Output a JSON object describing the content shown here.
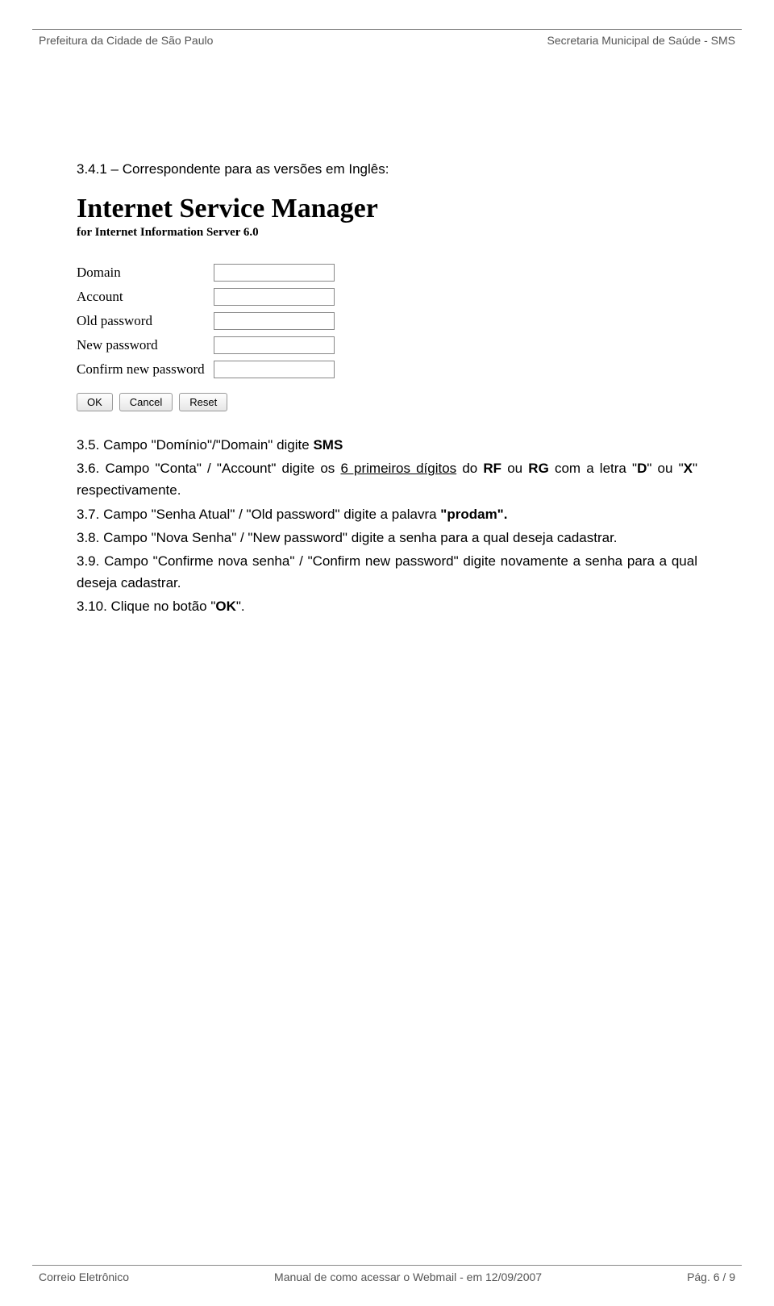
{
  "header": {
    "left": "Prefeitura da Cidade de São Paulo",
    "right": "Secretaria Municipal de Saúde - SMS"
  },
  "section_341": "3.4.1 – Correspondente para as versões em Inglês:",
  "ism": {
    "title": "Internet Service Manager",
    "subtitle": "for Internet Information Server 6.0",
    "labels": {
      "domain": "Domain",
      "account": "Account",
      "oldpw": "Old password",
      "newpw": "New password",
      "confirm": "Confirm new password"
    },
    "buttons": {
      "ok": "OK",
      "cancel": "Cancel",
      "reset": "Reset"
    }
  },
  "instructions": {
    "p35_a": "3.5. Campo \"Domínio\"/\"Domain\" digite ",
    "p35_b": "SMS",
    "p36_a": "3.6. Campo \"Conta\" / \"Account\" digite os ",
    "p36_u": "6 primeiros dígitos",
    "p36_b": " do ",
    "p36_rf": "RF",
    "p36_c": " ou ",
    "p36_rg": "RG",
    "p36_d": " com a letra \"",
    "p36_D": "D",
    "p36_e": "\" ou \"",
    "p36_X": "X",
    "p36_f": "\" respectivamente.",
    "p37_a": "3.7. Campo \"Senha Atual\" / \"Old password\" digite a palavra ",
    "p37_b": "\"prodam\".",
    "p38": "3.8. Campo \"Nova Senha\" / \"New password\" digite a senha para a qual deseja cadastrar.",
    "p39": "3.9. Campo \"Confirme nova senha\" / \"Confirm new password\" digite novamente a senha para a qual deseja cadastrar.",
    "p310_a": "3.10. Clique no botão \"",
    "p310_b": "OK",
    "p310_c": "\"."
  },
  "footer": {
    "left": "Correio Eletrônico",
    "center": "Manual de como acessar o Webmail -  em 12/09/2007",
    "right": "Pág. 6 / 9"
  }
}
